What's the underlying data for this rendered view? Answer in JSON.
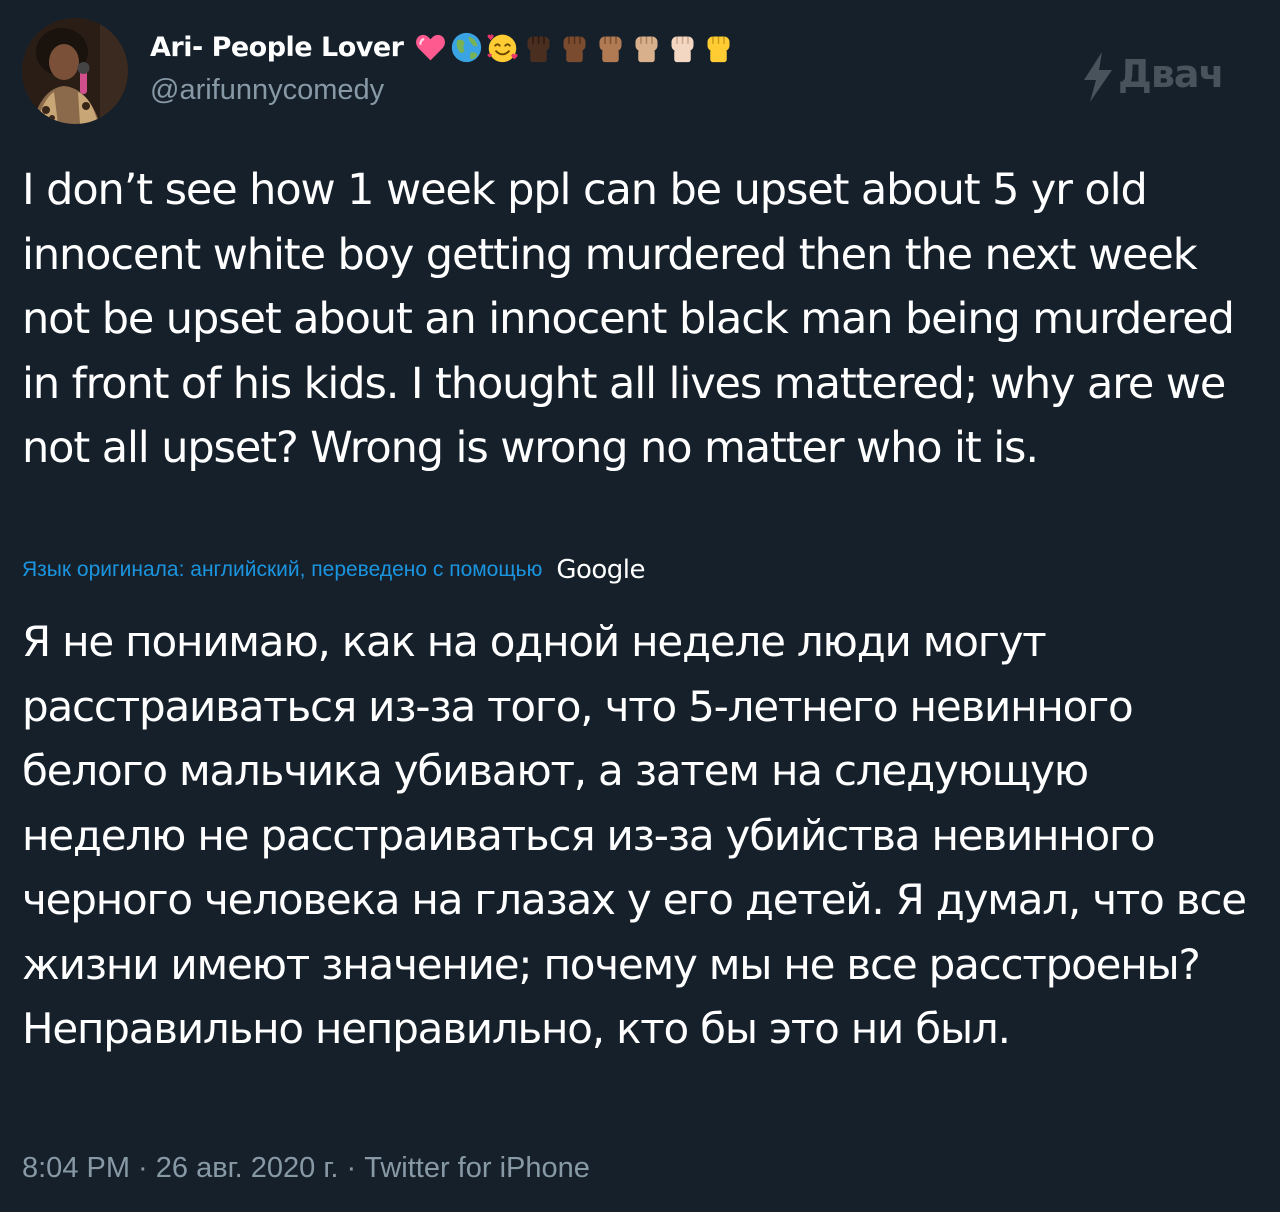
{
  "user": {
    "display_name": "Ari- People Lover",
    "handle": "@arifunnycomedy",
    "avatar_icon": "avatar-photo",
    "emojis": [
      {
        "name": "pink-heart-icon",
        "color": "#ff5a8f"
      },
      {
        "name": "globe-icon",
        "color": "#3aa3e3"
      },
      {
        "name": "smiling-face-with-hearts-icon",
        "color": "#ffcc33"
      },
      {
        "name": "raised-fist-dark-icon",
        "color": "#4a2e1f"
      },
      {
        "name": "raised-fist-medium-dark-icon",
        "color": "#7a4b2e"
      },
      {
        "name": "raised-fist-medium-icon",
        "color": "#b07a52"
      },
      {
        "name": "raised-fist-medium-light-icon",
        "color": "#d9b08c"
      },
      {
        "name": "raised-fist-light-icon",
        "color": "#f3d7c3"
      },
      {
        "name": "raised-fist-yellow-icon",
        "color": "#ffcc33"
      }
    ]
  },
  "watermark": {
    "text": "Двач",
    "icon": "lightning-icon"
  },
  "tweet": {
    "text": "I don’t see how 1 week ppl can be upset about 5 yr old innocent white boy getting murdered then the next week not be upset about an innocent black man being murdered in front of his kids. I thought all lives mattered; why are we not all upset? Wrong is wrong no matter who it is."
  },
  "translation": {
    "label": "Язык оригинала: английский, переведено с помощью",
    "provider": "Google",
    "text": "Я не понимаю, как на одной неделе люди могут расстраиваться из-за того, что 5-летнего невинного белого мальчика убивают, а затем на следующую неделю не расстраиваться из-за убийства невинного черного человека на глазах у его детей. Я думал, что все жизни имеют значение; почему мы не все расстроены? Неправильно неправильно, кто бы это ни был."
  },
  "meta": {
    "timestamp": "8:04 PM · 26 авг. 2020 г. · Twitter for iPhone"
  },
  "colors": {
    "background": "#15202b",
    "secondary_text": "#8899a6",
    "link": "#1b95e0"
  }
}
